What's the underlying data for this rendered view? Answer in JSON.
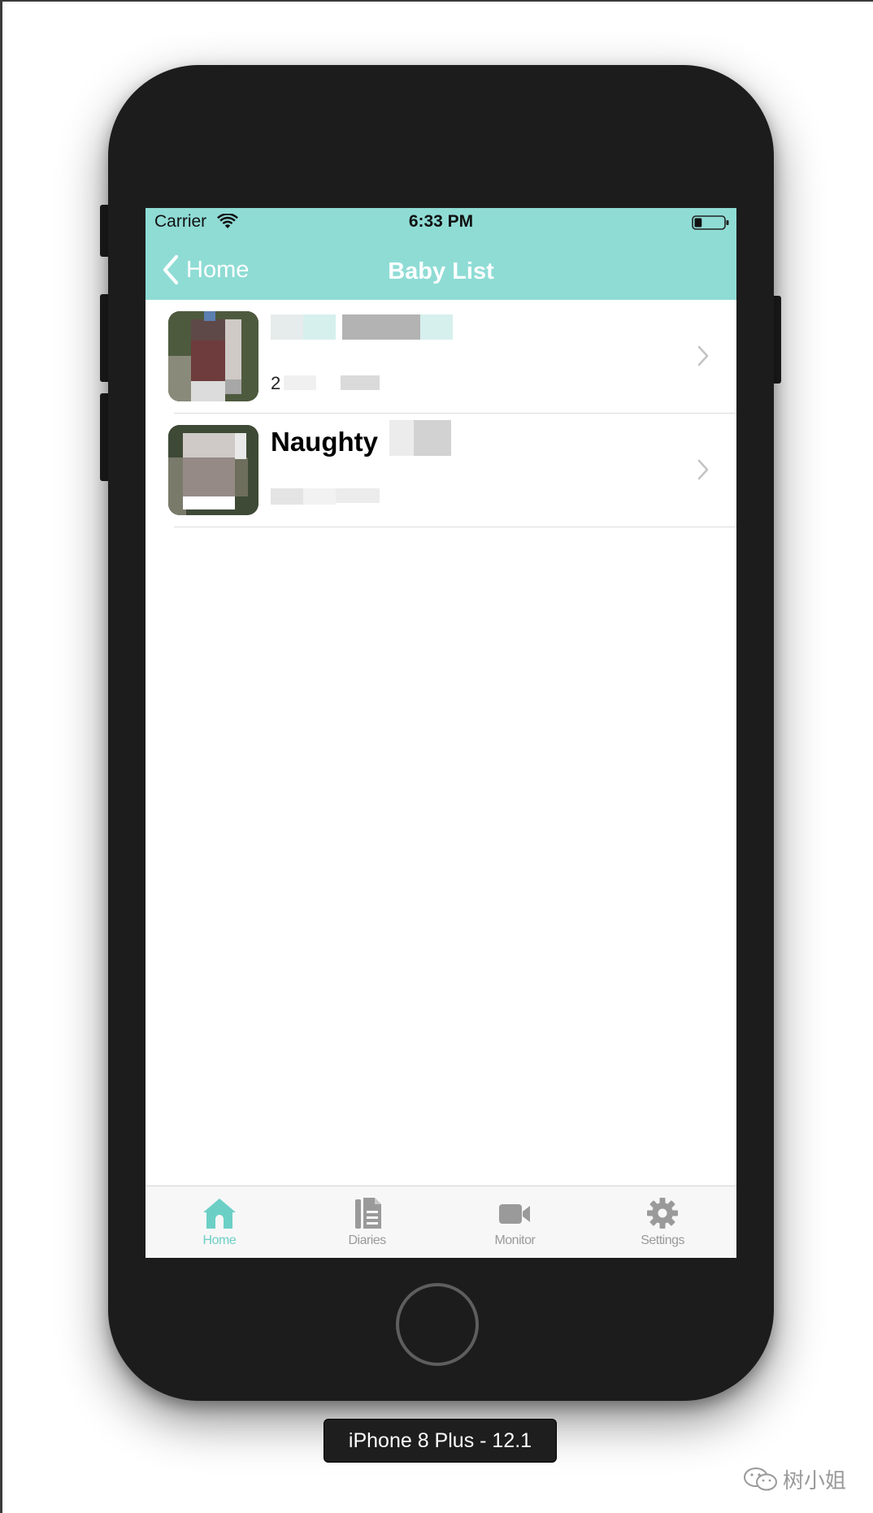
{
  "status_bar": {
    "carrier": "Carrier",
    "time": "6:33 PM",
    "battery_level": 0.25
  },
  "nav": {
    "back_label": "Home",
    "title": "Baby List"
  },
  "list": {
    "items": [
      {
        "name": "",
        "date": "2"
      },
      {
        "name": "Naughty",
        "date": ""
      }
    ]
  },
  "tabs": [
    {
      "label": "Home",
      "icon": "home-icon",
      "active": true
    },
    {
      "label": "Diaries",
      "icon": "document-icon",
      "active": false
    },
    {
      "label": "Monitor",
      "icon": "video-camera-icon",
      "active": false
    },
    {
      "label": "Settings",
      "icon": "gear-icon",
      "active": false
    }
  ],
  "device": {
    "label": "iPhone 8 Plus - 12.1"
  },
  "watermark": {
    "text": "树小姐"
  },
  "colors": {
    "accent": "#8fdcd5",
    "tab_active": "#6ccfc6",
    "tab_inactive": "#9a9a9a"
  }
}
